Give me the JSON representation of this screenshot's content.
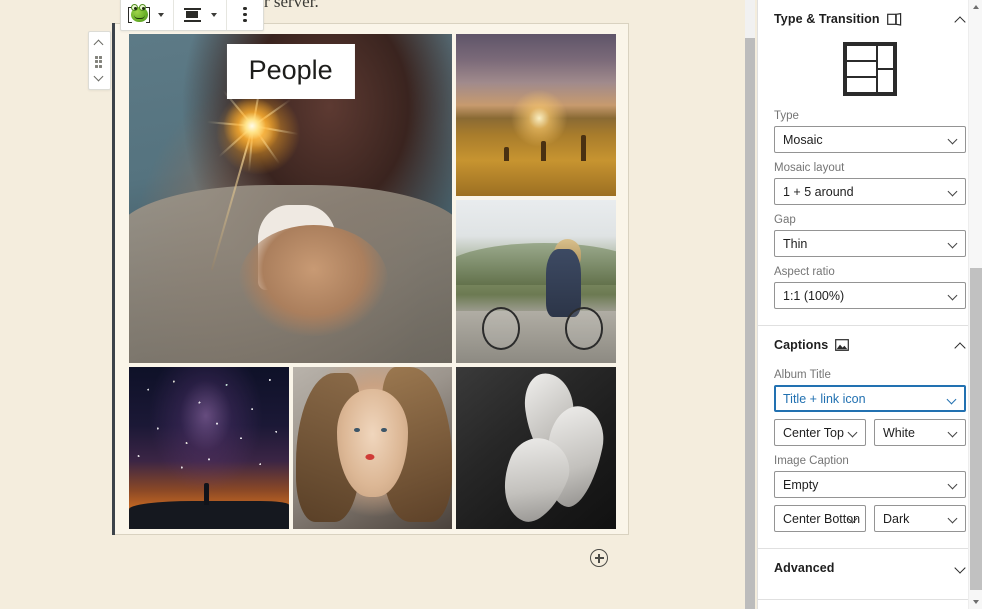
{
  "editor": {
    "paragraph_text": "n even be on another server.",
    "block_toolbar": {
      "block_type_icon": "nextgen-frog-icon",
      "block_type_dropdown_label": "Change block type",
      "align_icon": "align-center-icon",
      "align_dropdown_label": "Change alignment",
      "more_options_icon": "kebab-menu-icon"
    },
    "block_mover": {
      "move_up_icon": "chevron-up-icon",
      "drag_handle_icon": "drag-handle-icon",
      "move_down_icon": "chevron-down-icon"
    },
    "album_title": "People",
    "add_block_icon": "plus-circle-icon",
    "gallery_images": [
      {
        "name": "woman-holding-sparkler",
        "position": "large-left"
      },
      {
        "name": "sunset-field-silhouettes",
        "position": "top-right"
      },
      {
        "name": "woman-with-bicycle",
        "position": "middle-right"
      },
      {
        "name": "milky-way-stargazer",
        "position": "bottom-left"
      },
      {
        "name": "portrait-red-lips",
        "position": "bottom-center"
      },
      {
        "name": "black-white-feet",
        "position": "bottom-right"
      }
    ]
  },
  "sidebar": {
    "panels": [
      {
        "title": "Type & Transition",
        "icon": "book-flip-icon",
        "expanded": true,
        "chevron": "chevron-up-icon",
        "preview_icon": "mosaic-layout-preview",
        "fields": [
          {
            "label": "Type",
            "value": "Mosaic"
          },
          {
            "label": "Mosaic layout",
            "value": "1 + 5 around"
          },
          {
            "label": "Gap",
            "value": "Thin"
          },
          {
            "label": "Aspect ratio",
            "value": "1:1 (100%)"
          }
        ]
      },
      {
        "title": "Captions",
        "icon": "image-caption-icon",
        "expanded": true,
        "chevron": "chevron-up-icon",
        "album_title_label": "Album Title",
        "album_title_value": "Title + link icon",
        "album_title_position": "Center Top",
        "album_title_color": "White",
        "image_caption_label": "Image Caption",
        "image_caption_value": "Empty",
        "image_caption_position": "Center Botton",
        "image_caption_color": "Dark"
      },
      {
        "title": "Advanced",
        "icon": "",
        "expanded": false,
        "chevron": "chevron-down-icon"
      }
    ]
  },
  "colors": {
    "canvas_background": "#f4eddd",
    "block_background": "#faf5e9",
    "sidebar_background": "#ffffff",
    "focus_accent": "#2271b1",
    "label_text": "#757575",
    "body_text": "#1e1e1e"
  }
}
